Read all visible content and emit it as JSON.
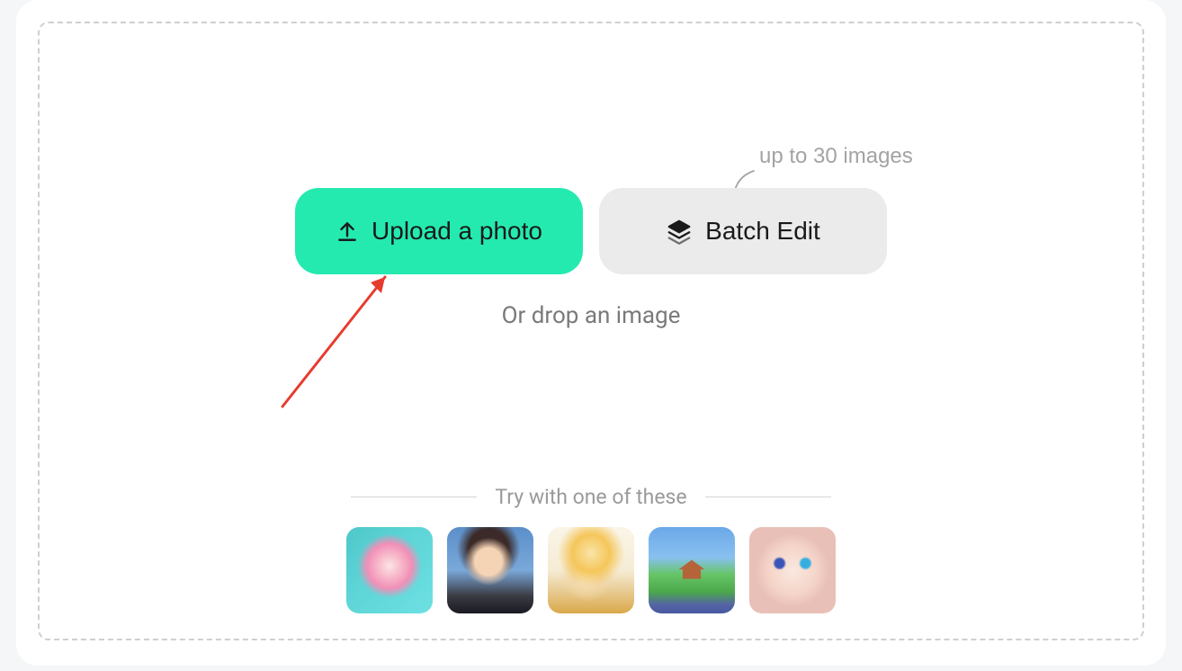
{
  "buttons": {
    "upload_label": "Upload a photo",
    "batch_label": "Batch Edit"
  },
  "annotation": {
    "text": "up to 30 images"
  },
  "drop_text": "Or drop an image",
  "samples": {
    "header": "Try with one of these",
    "items": [
      {
        "name": "sample-1"
      },
      {
        "name": "sample-2"
      },
      {
        "name": "sample-3"
      },
      {
        "name": "sample-4"
      },
      {
        "name": "sample-5"
      }
    ]
  }
}
